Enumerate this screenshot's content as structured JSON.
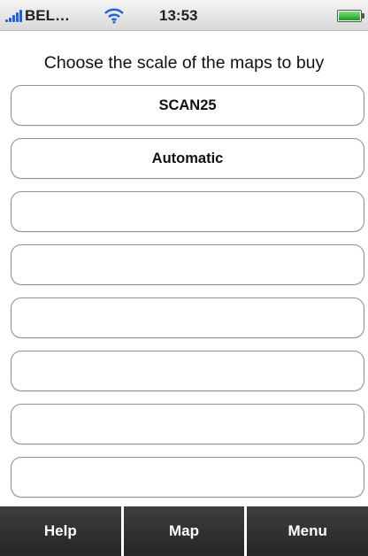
{
  "status_bar": {
    "carrier": "BEL…",
    "time": "13:53",
    "signal_icon": "signal-bars-icon",
    "wifi_icon": "wifi-icon",
    "battery_icon": "battery-icon"
  },
  "title": "Choose the scale of the maps to buy",
  "scale_options": [
    "SCAN25",
    "Automatic",
    "",
    "",
    "",
    "",
    "",
    ""
  ],
  "tabs": [
    "Help",
    "Map",
    "Menu"
  ],
  "colors": {
    "tabbar_background": "#2f2f2f",
    "tab_text": "#ffffff",
    "button_border": "#8e8e8e",
    "signal_blue": "#2060d8"
  }
}
